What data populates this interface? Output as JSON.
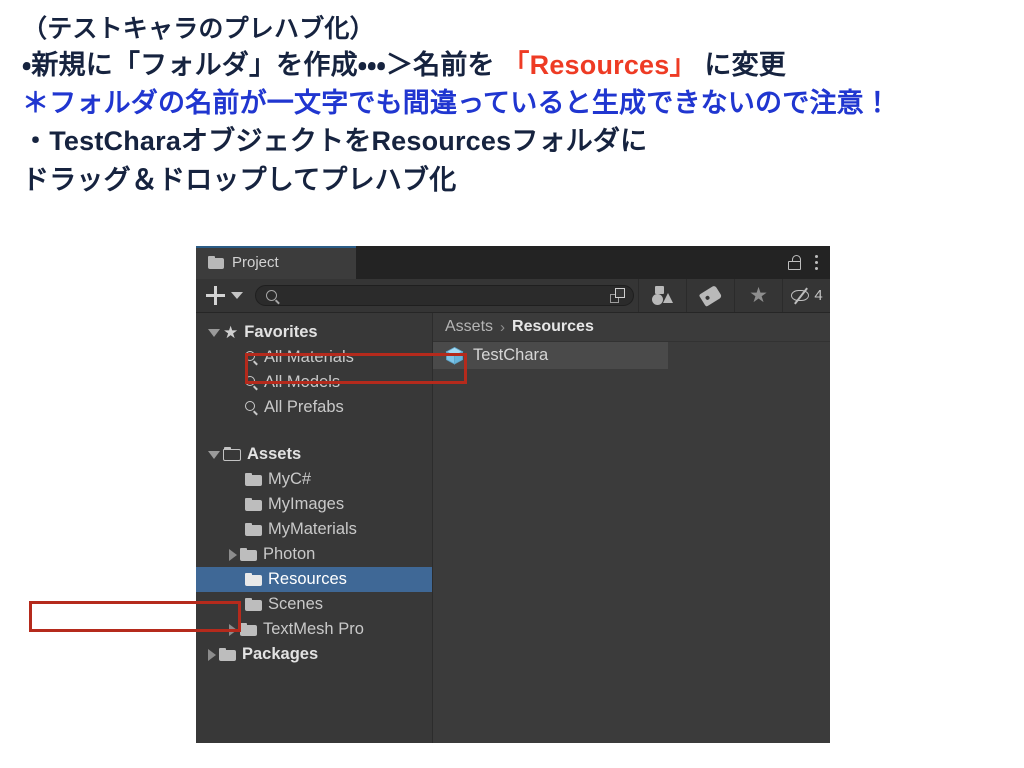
{
  "instructions": {
    "line1": "（テストキャラのプレハブ化）",
    "line2_a": "・新規に「フォルダ」を作成・・・＞名前を ",
    "line2_highlight": "「Resources」",
    "line2_b": " に変更",
    "line3": "＊フォルダの名前が一文字でも間違っていると生成できないので注意！",
    "line4": "・TestCharaオブジェクトをResourcesフォルダに",
    "line5": "ドラッグ＆ドロップしてプレハブ化",
    "colors": {
      "body_text": "#16233f",
      "highlight_red": "#ee3b24",
      "warning_blue": "#2036d0"
    }
  },
  "unity_window": {
    "tab": {
      "label": "Project",
      "icon": "folder-icon",
      "lock_icon": "unlocked-padlock-icon",
      "menu_icon": "kebab-menu-icon",
      "accent_color": "#2c5d87"
    },
    "toolbar": {
      "create_label": "+",
      "create_dropdown_icon": "chevron-down-icon",
      "search_value": "",
      "search_placeholder": "",
      "search_icon": "search-icon",
      "expand_icon": "expand-search-icon",
      "filters": [
        {
          "name": "type-filter",
          "icon": "shapes-icon"
        },
        {
          "name": "label-filter",
          "icon": "tag-icon"
        },
        {
          "name": "favorites-filter",
          "icon": "star-icon"
        },
        {
          "name": "hidden-packages-toggle",
          "icon": "eye-off-icon",
          "count": "4"
        }
      ]
    },
    "tree": {
      "rows": [
        {
          "label": "Favorites",
          "icon": "star-icon",
          "arrow": "down",
          "indent": 0,
          "bold": true,
          "selected": false
        },
        {
          "label": "All Materials",
          "icon": "magnifier-icon",
          "arrow": "none",
          "indent": 1,
          "bold": false,
          "selected": false
        },
        {
          "label": "All Models",
          "icon": "magnifier-icon",
          "arrow": "none",
          "indent": 1,
          "bold": false,
          "selected": false
        },
        {
          "label": "All Prefabs",
          "icon": "magnifier-icon",
          "arrow": "none",
          "indent": 1,
          "bold": false,
          "selected": false
        },
        {
          "label": "Assets",
          "icon": "folder-open-icon",
          "arrow": "down",
          "indent": 0,
          "bold": true,
          "selected": false
        },
        {
          "label": "MyC#",
          "icon": "folder-icon",
          "arrow": "none",
          "indent": 1,
          "bold": false,
          "selected": false
        },
        {
          "label": "MyImages",
          "icon": "folder-icon",
          "arrow": "none",
          "indent": 1,
          "bold": false,
          "selected": false
        },
        {
          "label": "MyMaterials",
          "icon": "folder-icon",
          "arrow": "none",
          "indent": 1,
          "bold": false,
          "selected": false
        },
        {
          "label": "Photon",
          "icon": "folder-icon",
          "arrow": "right",
          "indent": 1,
          "bold": false,
          "selected": false
        },
        {
          "label": "Resources",
          "icon": "folder-icon",
          "arrow": "none",
          "indent": 1,
          "bold": false,
          "selected": true
        },
        {
          "label": "Scenes",
          "icon": "folder-icon",
          "arrow": "none",
          "indent": 1,
          "bold": false,
          "selected": false
        },
        {
          "label": "TextMesh Pro",
          "icon": "folder-icon",
          "arrow": "right",
          "indent": 1,
          "bold": false,
          "selected": false
        },
        {
          "label": "Packages",
          "icon": "folder-icon",
          "arrow": "right",
          "indent": 0,
          "bold": true,
          "selected": false
        }
      ],
      "selection_color": "#3f6896"
    },
    "content": {
      "breadcrumb": {
        "root": "Assets",
        "separator": "›",
        "current": "Resources"
      },
      "items": [
        {
          "name": "TestChara",
          "icon": "prefab-cube-icon",
          "selected": true
        }
      ]
    },
    "annotation_color": "#b52a1c"
  }
}
